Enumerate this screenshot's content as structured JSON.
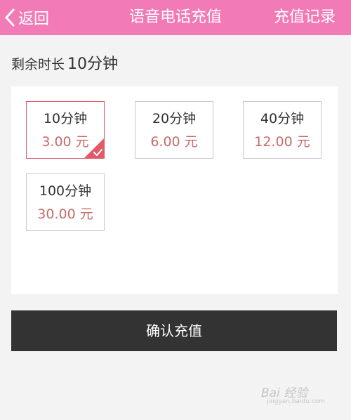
{
  "header": {
    "back_label": "返回",
    "title": "语音电话充值",
    "right_label": "充值记录",
    "background_color": "#f27bb7"
  },
  "remaining": {
    "label": "剩余时长",
    "value": "10分钟"
  },
  "options": [
    {
      "minutes": "10分钟",
      "price": "3.00 元",
      "selected": true
    },
    {
      "minutes": "20分钟",
      "price": "6.00 元",
      "selected": false
    },
    {
      "minutes": "40分钟",
      "price": "12.00 元",
      "selected": false
    },
    {
      "minutes": "100分钟",
      "price": "30.00 元",
      "selected": false
    }
  ],
  "confirm_button": {
    "label": "确认充值",
    "background_color": "#333333"
  },
  "accent": {
    "selected_color": "#e05a6a",
    "price_color": "#c96a6a"
  },
  "watermark": {
    "main": "Bai 经验",
    "sub": "jingyan.baidu.com"
  }
}
